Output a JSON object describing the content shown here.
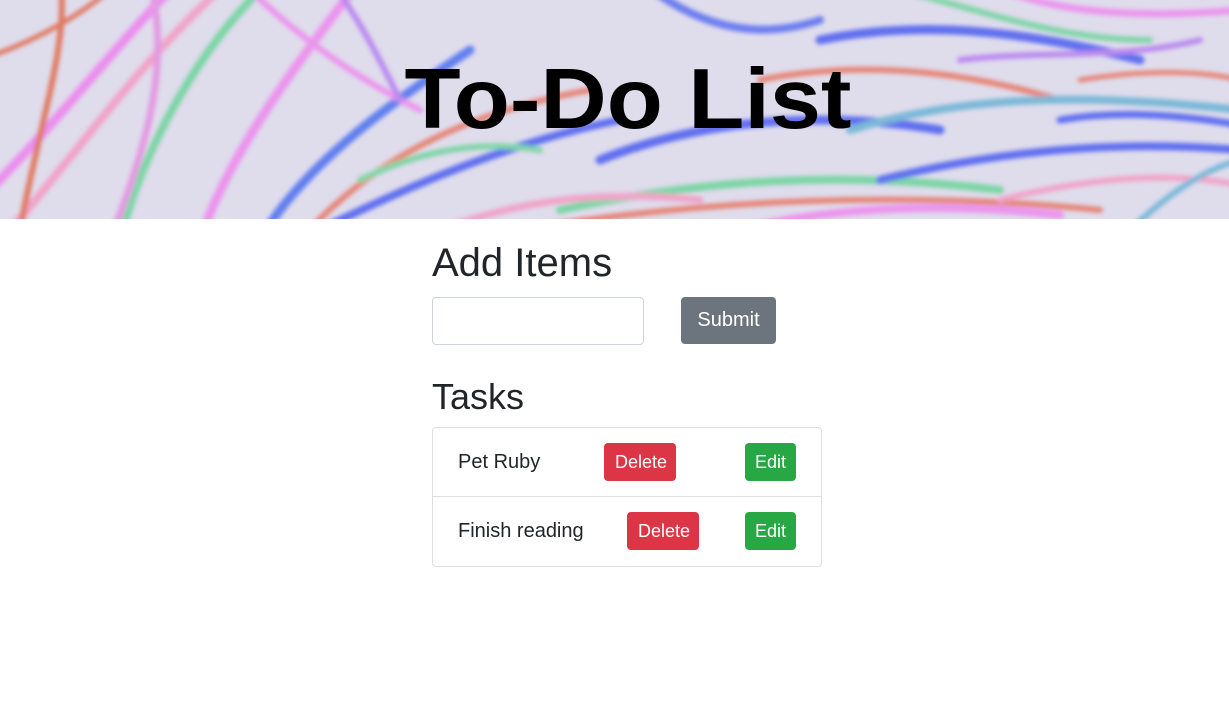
{
  "header": {
    "title": "To-Do List"
  },
  "add_section": {
    "heading": "Add Items",
    "input_value": "",
    "input_placeholder": "",
    "submit_label": "Submit"
  },
  "tasks_section": {
    "heading": "Tasks",
    "items": [
      {
        "label": "Pet Ruby",
        "delete_label": "Delete",
        "edit_label": "Edit"
      },
      {
        "label": "Finish reading",
        "delete_label": "Delete",
        "edit_label": "Edit"
      }
    ]
  },
  "colors": {
    "delete": "#dc3545",
    "edit": "#28a745",
    "submit": "#6c757d",
    "banner_bg": "#dfdcec"
  }
}
